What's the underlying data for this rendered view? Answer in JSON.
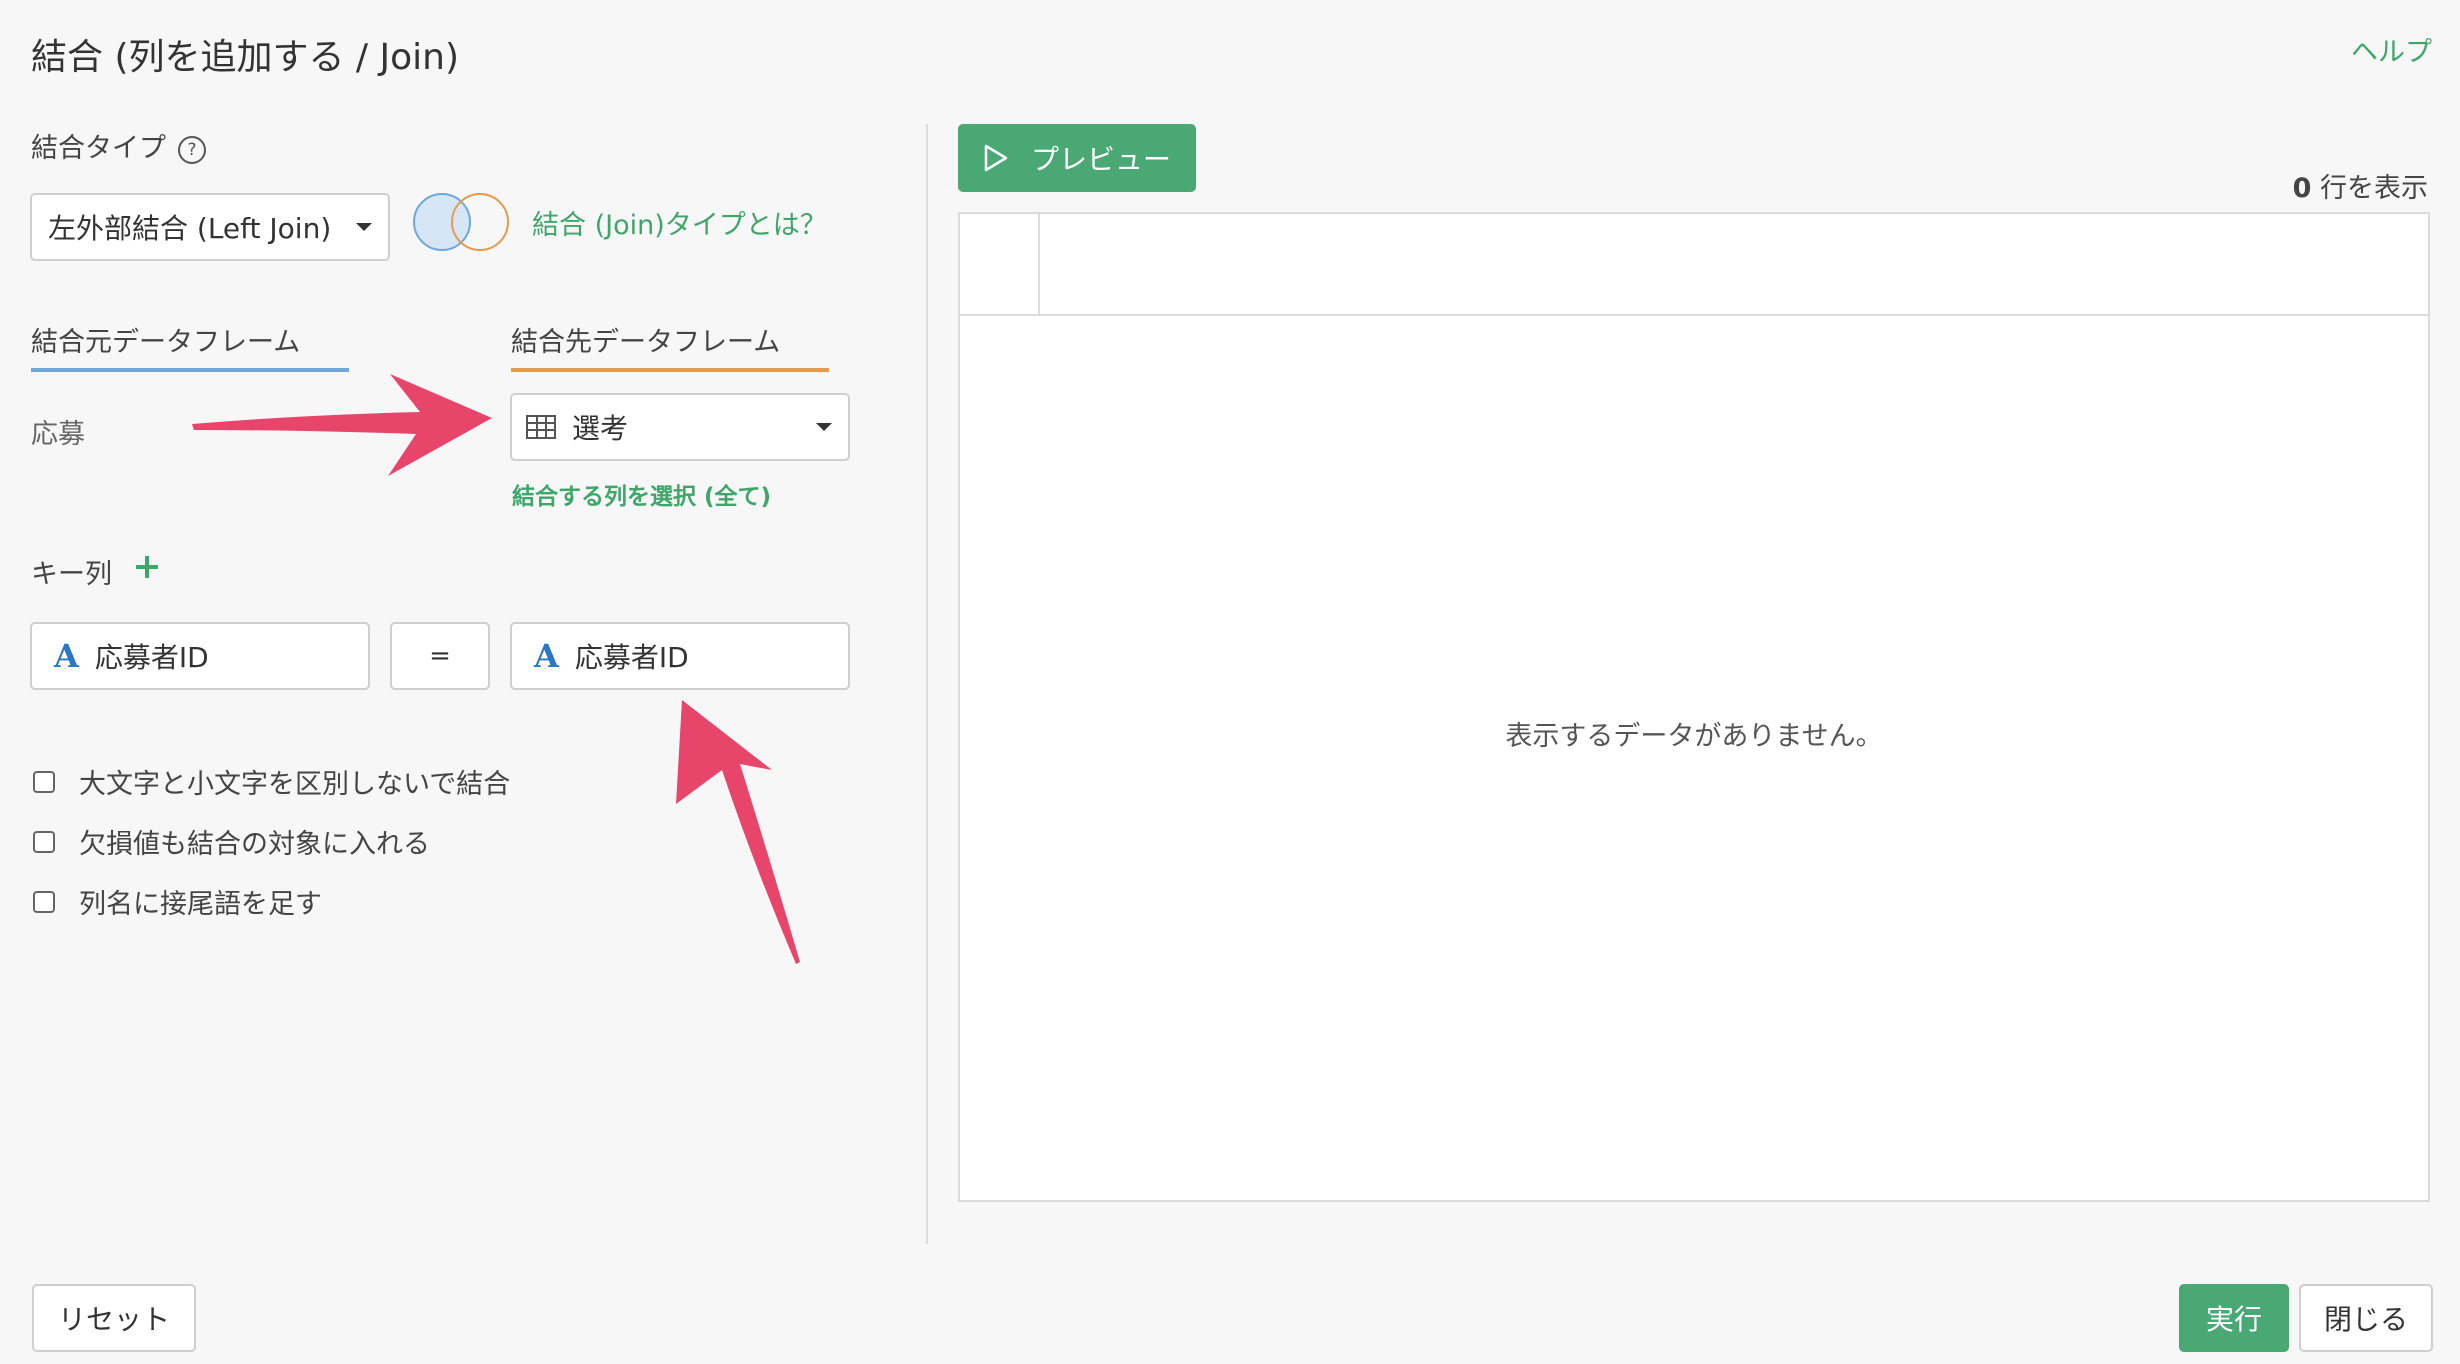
{
  "header": {
    "title": "結合 (列を追加する / Join)",
    "help": "ヘルプ"
  },
  "join_type": {
    "label": "結合タイプ",
    "help_icon": "question-circle-icon",
    "selected": "左外部結合 (Left Join)",
    "about_link": "結合 (Join)タイプとは？",
    "venn_colors": {
      "left": "#d6e6f7",
      "left_border": "#6ea7d9",
      "right_border": "#e59a4c"
    }
  },
  "source": {
    "tab_label": "結合元データフレーム",
    "value": "応募",
    "color": "#6ea7d9"
  },
  "target": {
    "tab_label": "結合先データフレーム",
    "selected": "選考",
    "icon": "table-icon",
    "select_columns_link": "結合する列を選択 (全て)",
    "color": "#e59a4c"
  },
  "key_columns": {
    "label": "キー列",
    "add_icon": "plus-icon",
    "left": {
      "type_icon": "A",
      "name": "応募者ID"
    },
    "operator": "=",
    "right": {
      "type_icon": "A",
      "name": "応募者ID"
    }
  },
  "options": [
    {
      "label": "大文字と小文字を区別しないで結合",
      "checked": false
    },
    {
      "label": "欠損値も結合の対象に入れる",
      "checked": false
    },
    {
      "label": "列名に接尾語を足す",
      "checked": false
    }
  ],
  "preview": {
    "button_label": "プレビュー",
    "play_icon": "play-outline-icon",
    "row_count": "0",
    "row_count_suffix": " 行を表示",
    "empty_message": "表示するデータがありません。"
  },
  "footer": {
    "reset": "リセット",
    "run": "実行",
    "close": "閉じる"
  },
  "annotation_arrow_color": "#e8456b"
}
